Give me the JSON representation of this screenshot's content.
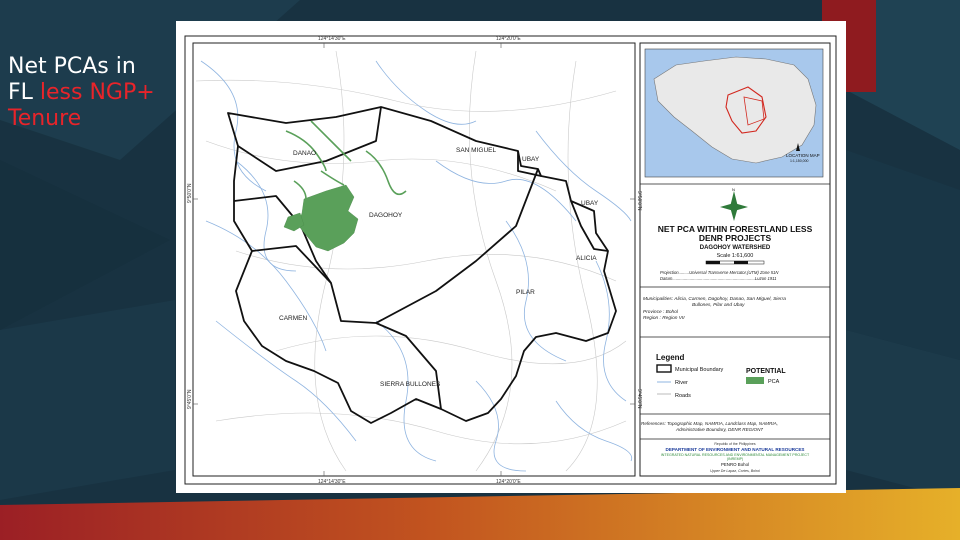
{
  "slide": {
    "title_line1": "Net PCAs in",
    "title_line2_a": "FL ",
    "title_line2_b": "less NGP+",
    "title_line3": "Tenure",
    "accent_color": "#e8242a"
  },
  "map": {
    "coords": {
      "top_left": "124°14'30\"E",
      "top_right": "124°20'0\"E",
      "bottom_left": "124°14'30\"E",
      "bottom_right": "124°20'0\"E",
      "left_upper": "9°50'0\"N",
      "left_lower": "9°45'0\"N",
      "right_upper": "9°50'0\"N",
      "right_lower": "9°45'0\"N"
    },
    "labels": {
      "danao": "DANAO",
      "san_miguel": "SAN MIGUEL",
      "ubay1": "UBAY",
      "ubay2": "UBAY",
      "dagohoy": "DAGOHOY",
      "alicia": "ALICIA",
      "pilar": "PILAR",
      "carmen": "CARMEN",
      "sierra": "SIERRA BULLONES"
    }
  },
  "panel": {
    "locmap_label": "LOCATION MAP",
    "locmap_scale": "1:1,150,000",
    "north_label": "N",
    "title1": "NET PCA WITHIN FORESTLAND LESS",
    "title2": "DENR PROJECTS",
    "subtitle": "DAGOHOY WATERSHED",
    "scale": "Scale 1:61,600",
    "projection": "Projection.........Universal Transverse Mercator,(UTM) Zone 51N",
    "datum": "Datum.......................................................................Luzon 1911",
    "municipalities_1": "Municipalities:  Alicia, Carmen, Dagohoy, Danao, San Miguel, Sierra",
    "municipalities_2": "Bullones, Pilar and Ubay",
    "province": "Province   :   Bohol",
    "region": "Region    :   Region VII",
    "legend_title": "Legend",
    "legend_boundary": "Municipal Boundary",
    "legend_river": "River",
    "legend_roads": "Roads",
    "legend_potential": "POTENTIAL",
    "legend_pca": "PCA",
    "references_1": "References: Topographic Map, NAMRIA, Landclass Map, NAMRIA,",
    "references_2": "Administrative Boundary, DENR REGION7",
    "republic": "Republic of the Philippines",
    "denr": "DEPARTMENT OF ENVIRONMENT AND NATURAL RESOURCES",
    "project_1": "INTEGRATED NATURAL RESOURCES AND ENVIRONMENTAL MANAGEMENT PROJECT",
    "project_2": "(INREMP)",
    "penro": "PENRO Bohol",
    "address": "Upper De Lapaz, Cortes, Bohol"
  },
  "colors": {
    "pca": "#5aa05a",
    "river": "#8fb4e0",
    "boundary": "#111111",
    "denr_blue": "#1a3a9a",
    "project_green": "#2f8a3a"
  }
}
